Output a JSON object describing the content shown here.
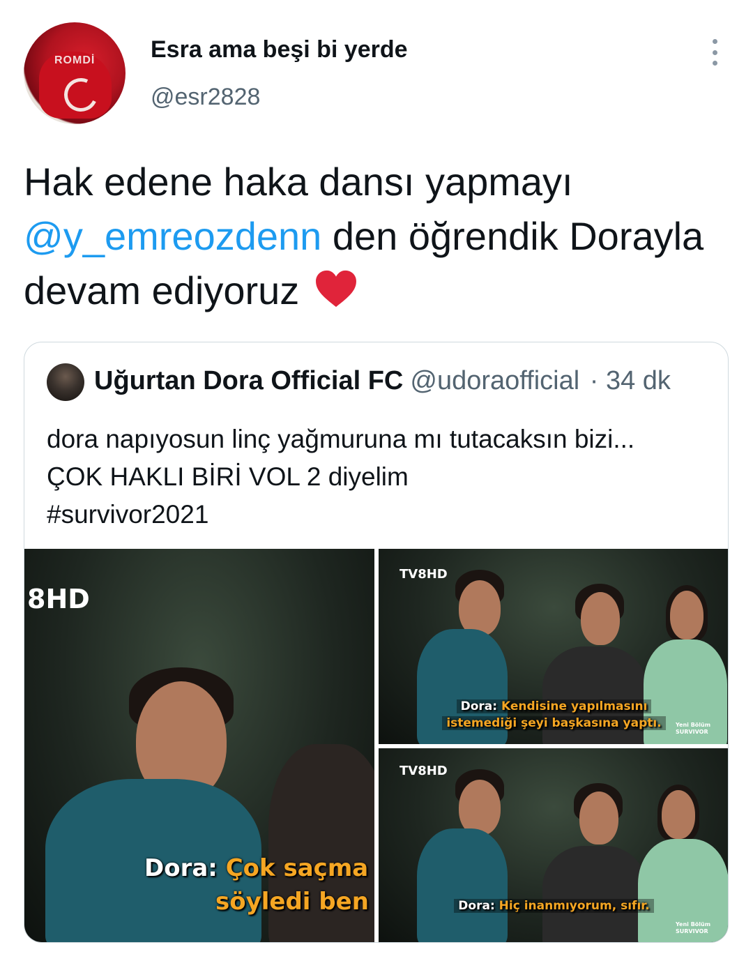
{
  "author": {
    "display_name": "Esra ama beşi bi yerde",
    "handle": "@esr2828",
    "avatar_text": "ROMDİ"
  },
  "tweet": {
    "text_part1": "Hak edene haka dansı yapmayı ",
    "mention": "@y_emreozdenn",
    "text_part2": " den öğrendik Dorayla devam ediyoruz",
    "emoji": "red-heart"
  },
  "quoted_tweet": {
    "display_name": "Uğurtan Dora Official FC",
    "handle": "@udoraofficial",
    "time": "· 34 dk",
    "lines": [
      "dora napıyosun linç yağmuruna mı tutacaksın bizi...",
      "ÇOK HAKLI BİRİ VOL 2 diyelim",
      "#survivor2021"
    ],
    "images": [
      {
        "channel_logo": "8HD",
        "speaker": "Dora:",
        "line1": "Çok saçma",
        "line2": "söyledi ben"
      },
      {
        "channel_logo": "TV8HD",
        "speaker": "Dora:",
        "line1": "Kendisine yapılmasını",
        "line2": "istemediği şeyi başkasına yaptı.",
        "corner_label": "Yeni Bölüm SURVIVOR"
      },
      {
        "channel_logo": "TV8HD",
        "speaker": "Dora:",
        "line1": "Hiç inanmıyorum, sıfır.",
        "corner_label": "Yeni Bölüm SURVIVOR"
      }
    ]
  },
  "colors": {
    "link": "#1d9bf0",
    "text": "#0f1419",
    "secondary": "#536471",
    "border": "#cfd9de",
    "subtitle_highlight": "#f5a623"
  }
}
